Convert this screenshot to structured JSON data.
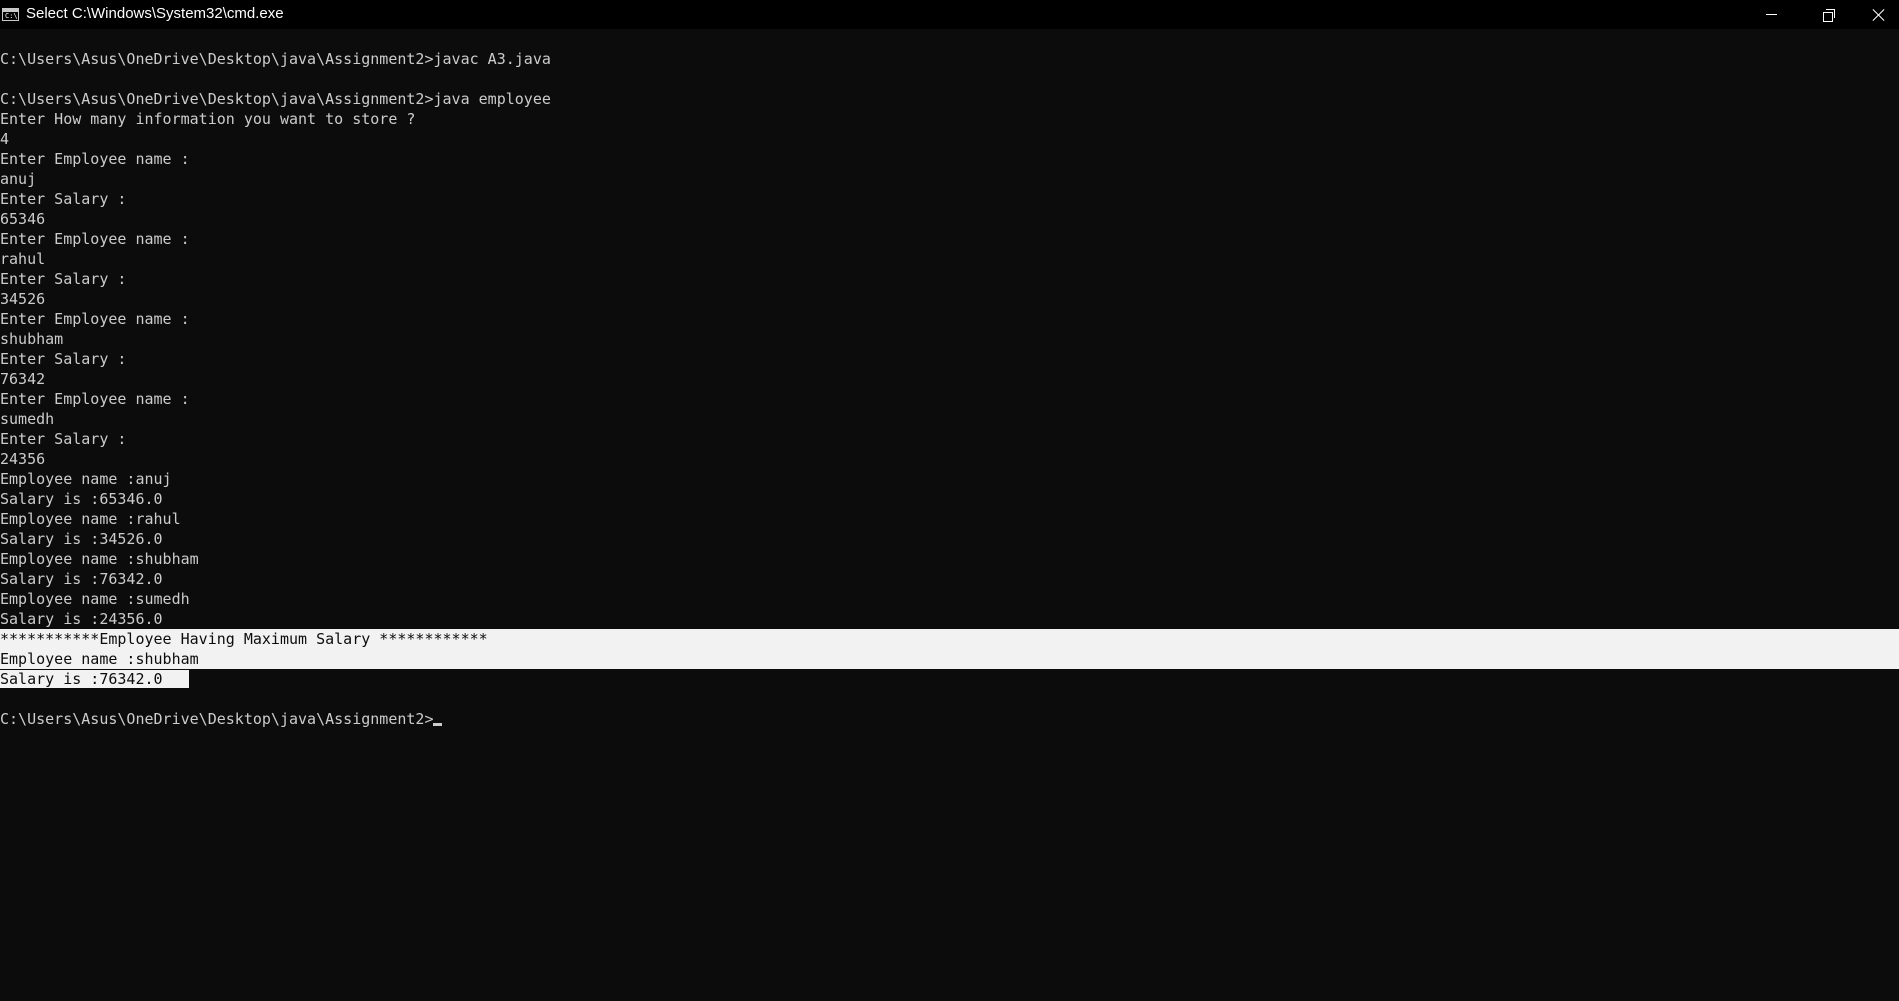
{
  "window": {
    "title": "Select C:\\Windows\\System32\\cmd.exe",
    "icon": "cmd-icon",
    "icon_glyph": "C:\\"
  },
  "controls": {
    "minimize": "minimize-icon",
    "restore": "restore-icon",
    "close": "close-icon"
  },
  "console": {
    "lines": [
      "C:\\Users\\Asus\\OneDrive\\Desktop\\java\\Assignment2>javac A3.java",
      "",
      "C:\\Users\\Asus\\OneDrive\\Desktop\\java\\Assignment2>java employee",
      "Enter How many information you want to store ?",
      "4",
      "Enter Employee name :",
      "anuj",
      "Enter Salary :",
      "65346",
      "Enter Employee name :",
      "rahul",
      "Enter Salary :",
      "34526",
      "Enter Employee name :",
      "shubham",
      "Enter Salary :",
      "76342",
      "Enter Employee name :",
      "sumedh",
      "Enter Salary :",
      "24356",
      "Employee name :anuj",
      "Salary is :65346.0",
      "Employee name :rahul",
      "Salary is :34526.0",
      "Employee name :shubham",
      "Salary is :76342.0",
      "Employee name :sumedh",
      "Salary is :24356.0",
      "***********Employee Having Maximum Salary ************",
      "Employee name :shubham",
      "Salary is :76342.0",
      "",
      "C:\\Users\\Asus\\OneDrive\\Desktop\\java\\Assignment2>"
    ]
  },
  "colors": {
    "background": "#0c0c0c",
    "text": "#cccccc",
    "selection": "#f2f2f2"
  }
}
